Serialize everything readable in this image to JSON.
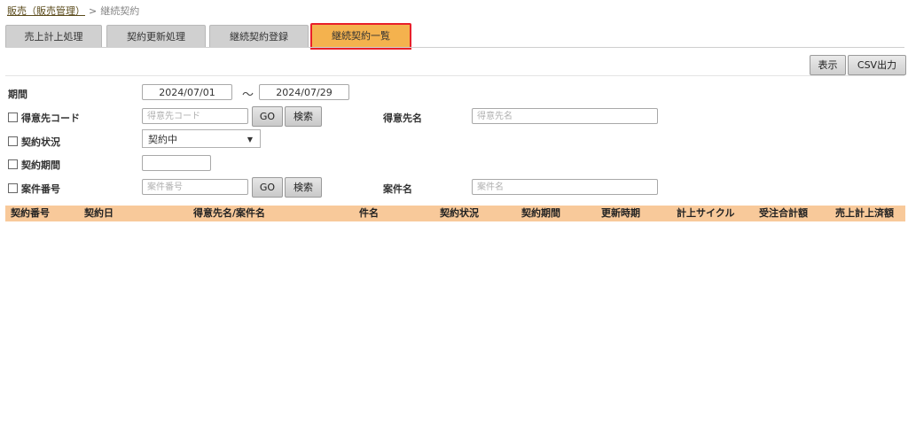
{
  "breadcrumb": {
    "parent": "販売（販売管理）",
    "separator": ">",
    "current": "継続契約"
  },
  "tabs": [
    {
      "label": "売上計上処理",
      "active": false
    },
    {
      "label": "契約更新処理",
      "active": false
    },
    {
      "label": "継続契約登録",
      "active": false
    },
    {
      "label": "継続契約一覧",
      "active": true
    }
  ],
  "toolbar": {
    "display_label": "表示",
    "csv_label": "CSV出力"
  },
  "filters": {
    "period": {
      "label": "期間",
      "from": "2024/07/01",
      "separator": "～",
      "to": "2024/07/29"
    },
    "customer_code": {
      "label": "得意先コード",
      "placeholder": "得意先コード",
      "go": "GO",
      "search": "検索"
    },
    "customer_name": {
      "label": "得意先名",
      "placeholder": "得意先名"
    },
    "contract_status": {
      "label": "契約状況",
      "selected": "契約中"
    },
    "contract_period": {
      "label": "契約期間",
      "value": ""
    },
    "case_number": {
      "label": "案件番号",
      "placeholder": "案件番号",
      "go": "GO",
      "search": "検索"
    },
    "case_name": {
      "label": "案件名",
      "placeholder": "案件名"
    }
  },
  "table": {
    "headers": [
      "契約番号",
      "契約日",
      "得意先名/案件名",
      "件名",
      "契約状況",
      "契約期間",
      "更新時期",
      "計上サイクル",
      "受注合計額",
      "売上計上済額"
    ],
    "rows": []
  },
  "colors": {
    "header_bg": "#f8c99a",
    "active_tab": "#f4b24e",
    "active_tab_border": "#e8202a"
  }
}
